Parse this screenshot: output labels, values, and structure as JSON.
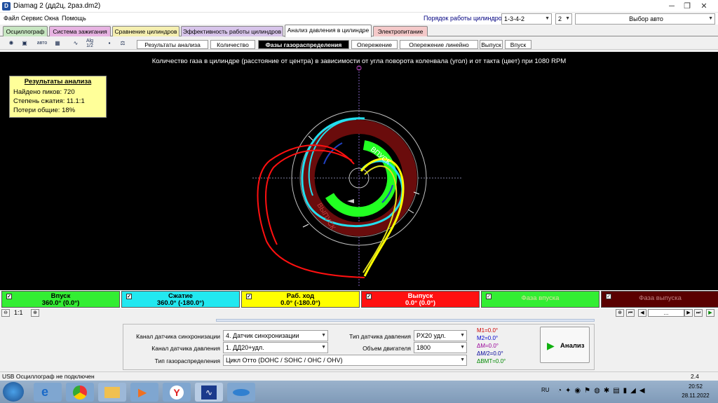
{
  "window": {
    "title": "Diamag 2 (дд2ц, 2рaз.dm2)",
    "minimize": "─",
    "maximize": "❐",
    "close": "✕"
  },
  "menu": [
    "Файл",
    "Сервис",
    "Окна",
    "Помощь"
  ],
  "cylinder_order": {
    "label": "Порядок работы цилиндров",
    "value": "1-3-4-2",
    "second": "2",
    "auto": "Выбор авто"
  },
  "main_tabs": [
    "Осциллограф",
    "Система зажигания",
    "Сравнение цилиндров",
    "Эффективность работы цилиндров",
    "Анализ давления в цилиндре",
    "Электропитание"
  ],
  "main_tab_colors": [
    "#c7e6c1",
    "#e7b3e2",
    "#f5efb0",
    "#d7c4ea",
    "#ffffff",
    "#f4c9c9"
  ],
  "active_main_tab": "Анализ давления в цилиндре",
  "sub_tabs": [
    "Результаты анализа",
    "Количество",
    "Фазы газораспределения",
    "Опережение",
    "Опережение линейно",
    "Выпуск",
    "Впуск"
  ],
  "active_sub_tab": "Фазы газораспределения",
  "toolbar_icons": [
    "settings-icon",
    "chip-icon",
    "auto-icon",
    "grid-icon",
    "graph-icon",
    "algorithm-icon",
    "save-icon",
    "scales-icon"
  ],
  "toolbar_labels": {
    "auto": "авто",
    "alg": "Alg",
    "half": "1/2"
  },
  "plot": {
    "title": "Количество газа в цилиндре (расстояние от центра) в зависимости от угла поворота коленвала (угол) и от такта (цвет) при 1080 RPM",
    "labels": {
      "intake": "ВПУСК",
      "exhaust": "ВЫПУСК"
    }
  },
  "results": {
    "title": "Результаты анализа",
    "lines": [
      "Найдено пиков: 720",
      "Степень сжатия: 11.1:1",
      "Потери общие: 18%"
    ]
  },
  "phases": [
    {
      "name": "Впуск",
      "value": "360.0° (0.0°)",
      "bg": "#33ee33",
      "fg": "#000000"
    },
    {
      "name": "Сжатие",
      "value": "360.0° (-180.0°)",
      "bg": "#22e8f0",
      "fg": "#000000"
    },
    {
      "name": "Раб. ход",
      "value": "0.0° (-180.0°)",
      "bg": "#ffff00",
      "fg": "#000000"
    },
    {
      "name": "Выпуск",
      "value": "0.0° (0.0°)",
      "bg": "#ff1010",
      "fg": "#ffffff"
    },
    {
      "name": "Фаза впуска",
      "value": "",
      "bg": "#33ee33",
      "fg": "#e0e0a0"
    },
    {
      "name": "Фаза выпуска",
      "value": "",
      "bg": "#5a0000",
      "fg": "#c08080"
    }
  ],
  "zoom": {
    "value": "1:1",
    "page": "..."
  },
  "settings": {
    "sync_channel_label": "Канал датчика синхронизации",
    "sync_channel_value": "4.  Датчик синхронизации",
    "pressure_channel_label": "Канал датчика давления",
    "pressure_channel_value": "1.  ДД20+удл.",
    "timing_type_label": "Тип газораспределения",
    "timing_type_value": "Цикл Отто (DOHC / SOHC / OHC / OHV)",
    "pressure_sensor_label": "Тип датчика давления",
    "pressure_sensor_value": "PX20 удл.",
    "engine_volume_label": "Объем двигателя",
    "engine_volume_value": "1800",
    "markers": [
      {
        "text": "M1=0.0°",
        "color": "#cc0000"
      },
      {
        "text": "M2=0.0°",
        "color": "#0000cc"
      },
      {
        "text": "ΔM=0.0°",
        "color": "#990099"
      },
      {
        "text": "ΔM/2=0.0°",
        "color": "#000099"
      },
      {
        "text": "ΔВМТ=0.0°",
        "color": "#008800"
      }
    ],
    "analyze_label": "Анализ"
  },
  "status": {
    "left": "USB Осциллограф не подключен",
    "right": "2.4"
  },
  "taskbar": {
    "lang": "RU",
    "time": "20:52",
    "date": "28.11.2022"
  }
}
